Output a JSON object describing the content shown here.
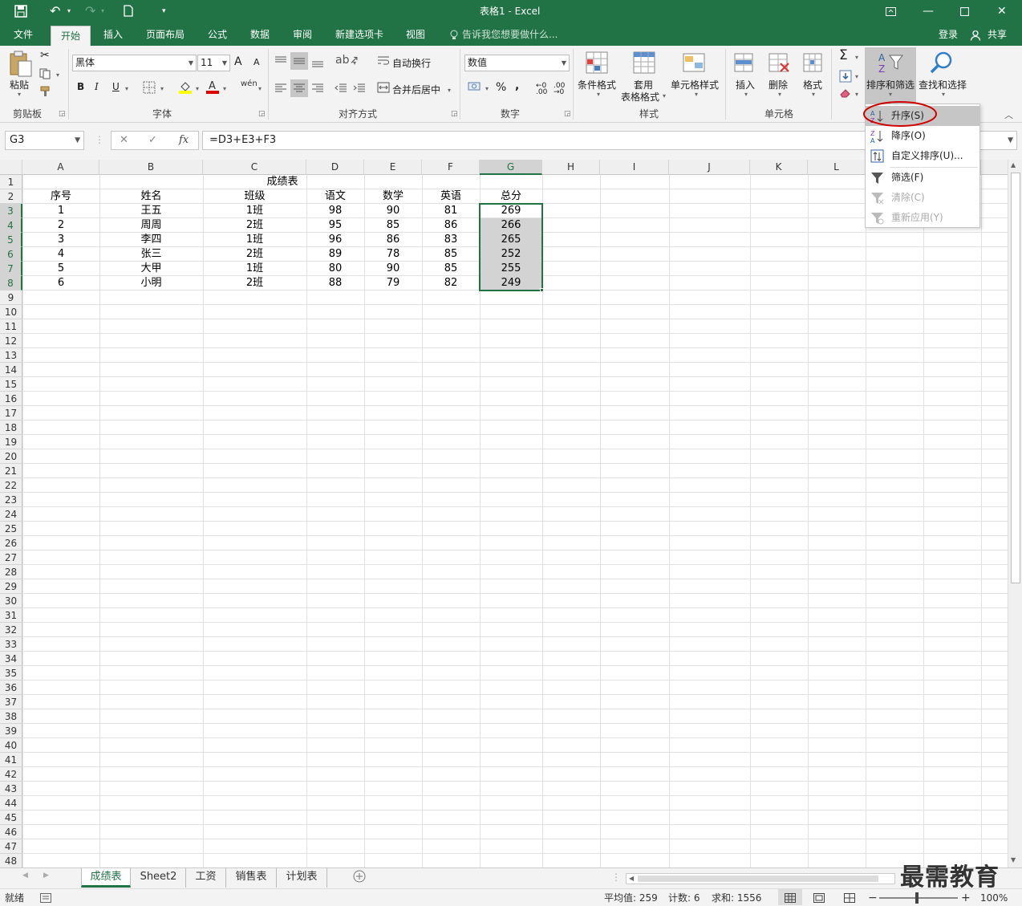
{
  "window": {
    "title": "表格1 - Excel",
    "login": "登录",
    "share": "共享"
  },
  "ribbon_tabs": [
    "文件",
    "开始",
    "插入",
    "页面布局",
    "公式",
    "数据",
    "审阅",
    "新建选项卡",
    "视图"
  ],
  "tell_me": "告诉我您想要做什么...",
  "ribbon": {
    "clipboard": {
      "paste": "粘贴",
      "label": "剪贴板"
    },
    "font": {
      "name": "黑体",
      "size": "11",
      "bold": "B",
      "italic": "I",
      "underline": "U",
      "label": "字体",
      "increase": "A",
      "decrease": "A",
      "phonetic": "wén"
    },
    "align": {
      "wrap": "自动换行",
      "merge": "合并后居中",
      "label": "对齐方式"
    },
    "number": {
      "format": "数值",
      "label": "数字",
      "percent": "%",
      "comma": ","
    },
    "styles": {
      "conditional": "条件格式",
      "table1": "套用",
      "table2": "表格格式",
      "cell": "单元格样式",
      "label": "样式"
    },
    "cells": {
      "insert": "插入",
      "delete": "删除",
      "format": "格式",
      "label": "单元格"
    },
    "editing": {
      "sum": "Σ",
      "sort": "排序和筛选",
      "find": "查找和选择"
    }
  },
  "formula_bar": {
    "cell_ref": "G3",
    "formula": "=D3+E3+F3",
    "cancel": "✕",
    "enter": "✓",
    "fx": "fx"
  },
  "columns": [
    "A",
    "B",
    "C",
    "D",
    "E",
    "F",
    "G",
    "H",
    "I",
    "J",
    "K",
    "L"
  ],
  "sheet": {
    "title": "成绩表",
    "headers": [
      "序号",
      "姓名",
      "班级",
      "语文",
      "数学",
      "英语",
      "总分"
    ],
    "rows": [
      [
        "1",
        "王五",
        "1班",
        "98",
        "90",
        "81",
        "269"
      ],
      [
        "2",
        "周周",
        "2班",
        "95",
        "85",
        "86",
        "266"
      ],
      [
        "3",
        "李四",
        "1班",
        "96",
        "86",
        "83",
        "265"
      ],
      [
        "4",
        "张三",
        "2班",
        "89",
        "78",
        "85",
        "252"
      ],
      [
        "5",
        "大甲",
        "1班",
        "80",
        "90",
        "85",
        "255"
      ],
      [
        "6",
        "小明",
        "2班",
        "88",
        "79",
        "82",
        "249"
      ]
    ]
  },
  "sort_menu": {
    "items": [
      "升序(S)",
      "降序(O)",
      "自定义排序(U)...",
      "筛选(F)",
      "清除(C)",
      "重新应用(Y)"
    ]
  },
  "sheet_tabs": [
    "成绩表",
    "Sheet2",
    "工资",
    "销售表",
    "计划表"
  ],
  "status": {
    "ready": "就绪",
    "average": "平均值: 259",
    "count": "计数: 6",
    "sum": "求和: 1556",
    "zoom": "100%"
  },
  "watermark": "最需教育",
  "colors": {
    "accent": "#217346",
    "highlight": "#d00000"
  }
}
